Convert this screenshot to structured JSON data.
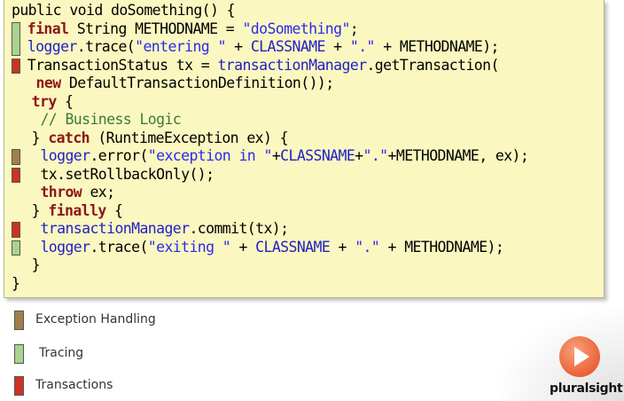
{
  "code": {
    "lines": [
      {
        "indent": 0,
        "tokens": [
          {
            "t": "public void doSomething() {",
            "c": "plain"
          }
        ]
      },
      {
        "indent": 1,
        "marker": "tracing",
        "tokens": [
          {
            "t": "final",
            "c": "kw"
          },
          {
            "t": " String METHODNAME = ",
            "c": "plain"
          },
          {
            "t": "\"doSomething\"",
            "c": "str"
          },
          {
            "t": ";",
            "c": "plain"
          }
        ]
      },
      {
        "indent": 1,
        "marker": "tracing",
        "tokens": [
          {
            "t": "logger",
            "c": "fld"
          },
          {
            "t": ".trace(",
            "c": "plain"
          },
          {
            "t": "\"entering \"",
            "c": "str"
          },
          {
            "t": " + ",
            "c": "plain"
          },
          {
            "t": "CLASSNAME",
            "c": "fld"
          },
          {
            "t": " + ",
            "c": "plain"
          },
          {
            "t": "\".\"",
            "c": "str"
          },
          {
            "t": " + METHODNAME);",
            "c": "plain"
          }
        ]
      },
      {
        "indent": 1,
        "marker": "transactions",
        "tokens": [
          {
            "t": "TransactionStatus tx = ",
            "c": "plain"
          },
          {
            "t": "transactionManager",
            "c": "fld"
          },
          {
            "t": ".getTransaction(",
            "c": "plain"
          }
        ]
      },
      {
        "indent": 2,
        "tokens": [
          {
            "t": "new",
            "c": "kw"
          },
          {
            "t": " DefaultTransactionDefinition());",
            "c": "plain"
          }
        ]
      },
      {
        "indent": 1.5,
        "tokens": [
          {
            "t": "try",
            "c": "kw"
          },
          {
            "t": " {",
            "c": "plain"
          }
        ]
      },
      {
        "indent": 2.5,
        "tokens": [
          {
            "t": "// Business Logic",
            "c": "cmt"
          }
        ]
      },
      {
        "indent": 1.5,
        "tokens": [
          {
            "t": "} ",
            "c": "plain"
          },
          {
            "t": "catch",
            "c": "kw"
          },
          {
            "t": " (RuntimeException ex) {",
            "c": "plain"
          }
        ]
      },
      {
        "indent": 2.5,
        "marker": "exception",
        "tokens": [
          {
            "t": "logger",
            "c": "fld"
          },
          {
            "t": ".error(",
            "c": "plain"
          },
          {
            "t": "\"exception in \"",
            "c": "str"
          },
          {
            "t": "+",
            "c": "plain"
          },
          {
            "t": "CLASSNAME",
            "c": "fld"
          },
          {
            "t": "+",
            "c": "plain"
          },
          {
            "t": "\".\"",
            "c": "str"
          },
          {
            "t": "+METHODNAME, ex);",
            "c": "plain"
          }
        ]
      },
      {
        "indent": 2.5,
        "marker": "transactions",
        "tokens": [
          {
            "t": "tx.setRollbackOnly();",
            "c": "plain"
          }
        ]
      },
      {
        "indent": 2.5,
        "tokens": [
          {
            "t": "throw",
            "c": "kw"
          },
          {
            "t": " ex;",
            "c": "plain"
          }
        ]
      },
      {
        "indent": 1.5,
        "tokens": [
          {
            "t": "} ",
            "c": "plain"
          },
          {
            "t": "finally",
            "c": "kw"
          },
          {
            "t": " {",
            "c": "plain"
          }
        ]
      },
      {
        "indent": 2.5,
        "marker": "transactions",
        "tokens": [
          {
            "t": "transactionManager",
            "c": "fld"
          },
          {
            "t": ".commit(tx);",
            "c": "plain"
          }
        ]
      },
      {
        "indent": 2.5,
        "marker": "tracing",
        "tokens": [
          {
            "t": "logger",
            "c": "fld"
          },
          {
            "t": ".trace(",
            "c": "plain"
          },
          {
            "t": "\"exiting \"",
            "c": "str"
          },
          {
            "t": " + ",
            "c": "plain"
          },
          {
            "t": "CLASSNAME",
            "c": "fld"
          },
          {
            "t": " + ",
            "c": "plain"
          },
          {
            "t": "\".\"",
            "c": "str"
          },
          {
            "t": " + METHODNAME);",
            "c": "plain"
          }
        ]
      },
      {
        "indent": 1.5,
        "tokens": [
          {
            "t": "}",
            "c": "plain"
          }
        ]
      },
      {
        "indent": 0,
        "tokens": [
          {
            "t": "}",
            "c": "plain"
          }
        ]
      }
    ]
  },
  "legend": {
    "items": [
      {
        "key": "exception",
        "label": "Exception Handling"
      },
      {
        "key": "tracing",
        "label": "Tracing"
      },
      {
        "key": "transactions",
        "label": "Transactions"
      }
    ]
  },
  "colors": {
    "exception": "#a0804a",
    "tracing": "#a8d48e",
    "transactions": "#cc3322",
    "accent": "#f0764a"
  },
  "brand": {
    "name": "pluralsight",
    "icon": "play-icon"
  }
}
